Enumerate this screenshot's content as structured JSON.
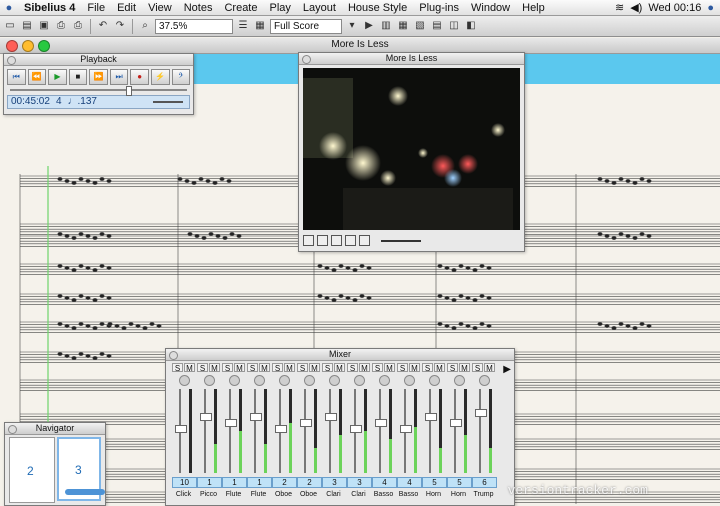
{
  "menubar": {
    "app": "Sibelius 4",
    "items": [
      "File",
      "Edit",
      "View",
      "Notes",
      "Create",
      "Play",
      "Layout",
      "House Style",
      "Plug-ins",
      "Window",
      "Help"
    ],
    "clock": "Wed 00:16"
  },
  "toolbar": {
    "zoom": "37.5%",
    "view_mode": "Full Score"
  },
  "document": {
    "title": "More Is Less"
  },
  "playback": {
    "title": "Playback",
    "buttons": [
      "⏮",
      "⏪",
      "▶",
      "■",
      "⏩",
      "⏭",
      "●",
      "⚡",
      "𝄢"
    ],
    "time": "00:45:02",
    "meter": "4",
    "tempo": "♩.137"
  },
  "movie": {
    "title": "More Is Less"
  },
  "mixer": {
    "title": "Mixer",
    "channels": [
      {
        "num": "10",
        "name": "Click",
        "level": 0.55,
        "meter": 0.0
      },
      {
        "num": "1",
        "name": "Picco",
        "level": 0.7,
        "meter": 0.35
      },
      {
        "num": "1",
        "name": "Flute",
        "level": 0.62,
        "meter": 0.5
      },
      {
        "num": "1",
        "name": "Flute",
        "level": 0.7,
        "meter": 0.35
      },
      {
        "num": "2",
        "name": "Oboe",
        "level": 0.55,
        "meter": 0.6
      },
      {
        "num": "2",
        "name": "Oboe",
        "level": 0.62,
        "meter": 0.3
      },
      {
        "num": "3",
        "name": "Clari",
        "level": 0.7,
        "meter": 0.45
      },
      {
        "num": "3",
        "name": "Clari",
        "level": 0.55,
        "meter": 0.5
      },
      {
        "num": "4",
        "name": "Basso",
        "level": 0.62,
        "meter": 0.4
      },
      {
        "num": "4",
        "name": "Basso",
        "level": 0.55,
        "meter": 0.55
      },
      {
        "num": "5",
        "name": "Horn",
        "level": 0.7,
        "meter": 0.3
      },
      {
        "num": "5",
        "name": "Horn",
        "level": 0.62,
        "meter": 0.45
      },
      {
        "num": "6",
        "name": "Trump",
        "level": 0.75,
        "meter": 0.3
      }
    ]
  },
  "navigator": {
    "title": "Navigator",
    "pages": [
      "2",
      "3"
    ]
  },
  "watermark": "versiontracker.com",
  "colors": {
    "accent": "#5bc8ee",
    "meter_green": "#6cd35a",
    "channel_blue": "#bfe2f7"
  }
}
